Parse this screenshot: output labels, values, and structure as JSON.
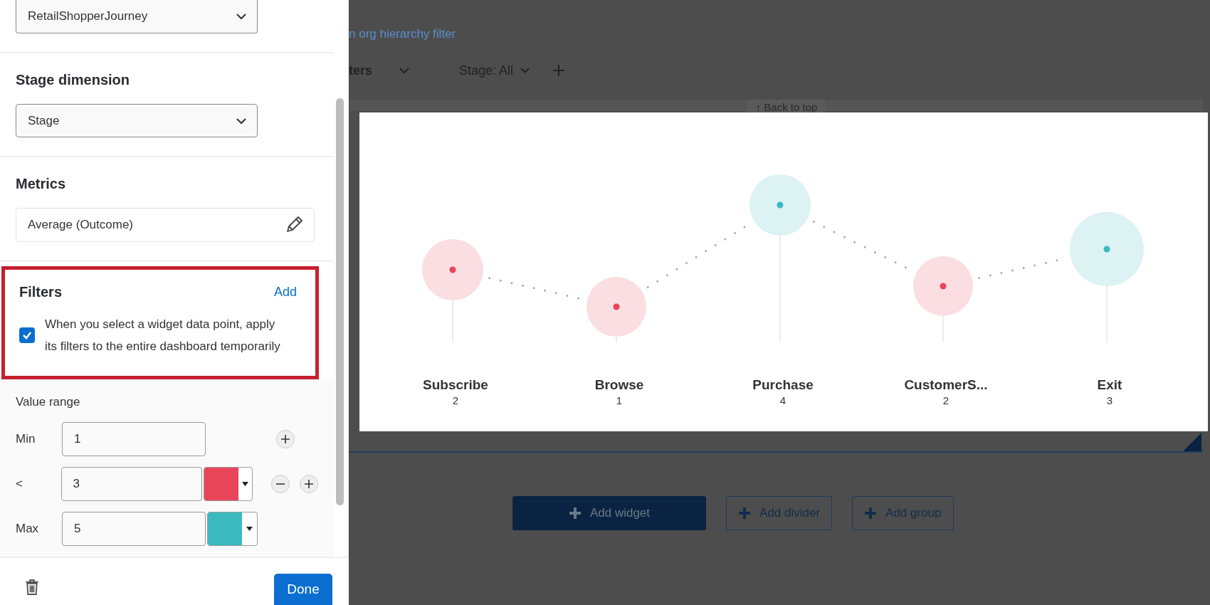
{
  "panel": {
    "journey_dropdown": {
      "value": "RetailShopperJourney"
    },
    "stage_dimension": {
      "title": "Stage dimension",
      "value": "Stage"
    },
    "metrics": {
      "title": "Metrics",
      "value": "Average (Outcome)"
    },
    "filters": {
      "title": "Filters",
      "add_link": "Add",
      "highlighted": true,
      "checkbox": {
        "label": "When you select a widget data point, apply its filters to the entire dashboard temporarily",
        "checked": true
      }
    },
    "value_range": {
      "title": "Value range",
      "rows": [
        {
          "label": "Min",
          "value": "1",
          "buttons": [
            {
              "kind": "plus"
            }
          ]
        },
        {
          "label": "<",
          "value": "3",
          "color": "#e8455a",
          "buttons": [
            {
              "kind": "minus"
            },
            {
              "kind": "plus"
            }
          ]
        },
        {
          "label": "Max",
          "value": "5",
          "color": "#3bb9bf"
        }
      ]
    },
    "done_button": "Done"
  },
  "dashboard": {
    "link": "n org hierarchy filter",
    "filters_label": "ters",
    "stage_filter": "Stage: All",
    "back_to_top": "↑ Back to top",
    "buttons": [
      {
        "label": "Add widget",
        "kind": "primary"
      },
      {
        "label": "Add divider",
        "kind": "outline"
      },
      {
        "label": "Add group",
        "kind": "outline"
      }
    ]
  },
  "chart": {
    "stages": [
      {
        "name": "Subscribe",
        "count": "2",
        "color": "#e8455a"
      },
      {
        "name": "Browse",
        "count": "1",
        "color": "#e8455a"
      },
      {
        "name": "Purchase",
        "count": "4",
        "color": "#3bb9bf"
      },
      {
        "name": "CustomerS...",
        "count": "2",
        "color": "#e8455a"
      },
      {
        "name": "Exit",
        "count": "3",
        "color": "#3bb9bf"
      }
    ]
  }
}
